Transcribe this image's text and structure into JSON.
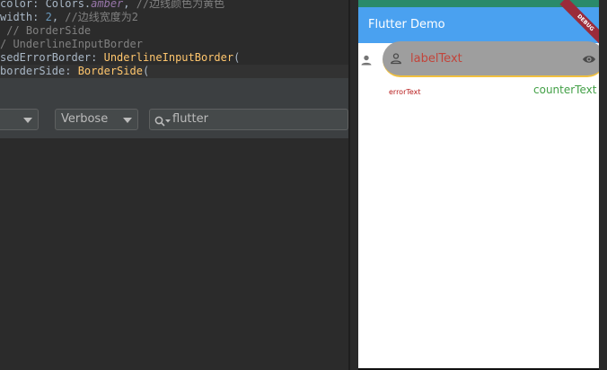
{
  "code": {
    "lines": [
      {
        "parts": [
          [
            "k",
            "color: Colors."
          ],
          [
            "i",
            "amber"
          ],
          [
            "k",
            ", "
          ],
          [
            "c",
            "//边线颜色为黄色"
          ]
        ]
      },
      {
        "parts": [
          [
            "k",
            "width: "
          ],
          [
            "n",
            "2"
          ],
          [
            "k",
            ", "
          ],
          [
            "c",
            "//边线宽度为2"
          ]
        ]
      },
      {
        "parts": [
          [
            "c",
            " // BorderSide"
          ]
        ]
      },
      {
        "parts": [
          [
            "c",
            "/ UnderlineInputBorder"
          ]
        ]
      },
      {
        "parts": [
          [
            "k",
            "sedErrorBorder: "
          ],
          [
            "f",
            "UnderlineInputBorder"
          ],
          [
            "k",
            "("
          ]
        ]
      },
      {
        "parts": [
          [
            "k",
            "borderSide: "
          ],
          [
            "f",
            "BorderSide"
          ],
          [
            "k",
            "("
          ]
        ]
      }
    ]
  },
  "logcat": {
    "level": "Verbose",
    "search_value": "flutter"
  },
  "app": {
    "title": "Flutter Demo",
    "debug_banner": "DEBUG",
    "field": {
      "label": "labelText",
      "error": "errorText",
      "counter": "counterText"
    }
  },
  "colors": {
    "appbar": "#4aa1f0",
    "fill": "#9e9e9e",
    "label": "#c2443a",
    "error": "#b71c1c",
    "counter": "#43a047",
    "underline": "#f0c040"
  },
  "icons": [
    "person-icon",
    "eye-icon",
    "search-icon",
    "chevron-down-icon"
  ]
}
